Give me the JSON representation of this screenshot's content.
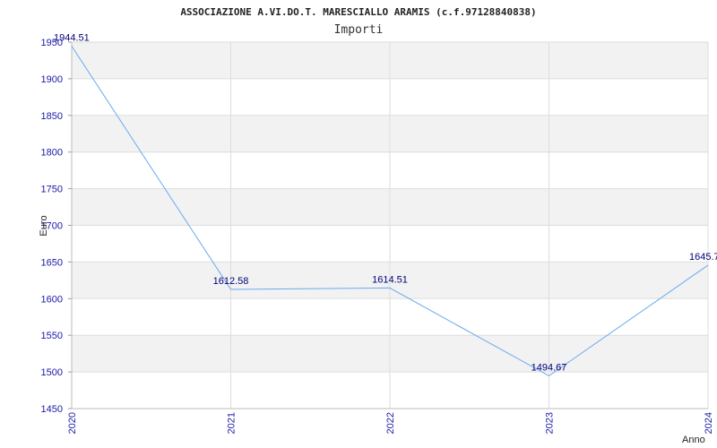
{
  "chart_data": {
    "type": "line",
    "title": "ASSOCIAZIONE A.VI.DO.T. MARESCIALLO ARAMIS (c.f.97128840838)",
    "subtitle": "Importi",
    "xlabel": "Anno",
    "ylabel": "Euro",
    "categories": [
      "2020",
      "2021",
      "2022",
      "2023",
      "2024"
    ],
    "series": [
      {
        "values": [
          1944.51,
          1612.58,
          1614.51,
          1494.67,
          1645.7
        ],
        "data_labels": [
          "1944.51",
          "1612.58",
          "1614.51",
          "1494.67",
          "1645.7"
        ]
      }
    ],
    "ylim": [
      1450,
      1950
    ],
    "yticks": [
      "1450",
      "1500",
      "1550",
      "1600",
      "1650",
      "1700",
      "1750",
      "1800",
      "1850",
      "1900",
      "1950"
    ],
    "grid": true,
    "colors": {
      "line": "#6aaaf0",
      "band": "#f2f2f2",
      "grid": "#dddddd",
      "tick_text": "#1a1aa6",
      "data_label_text": "#00007a"
    }
  }
}
